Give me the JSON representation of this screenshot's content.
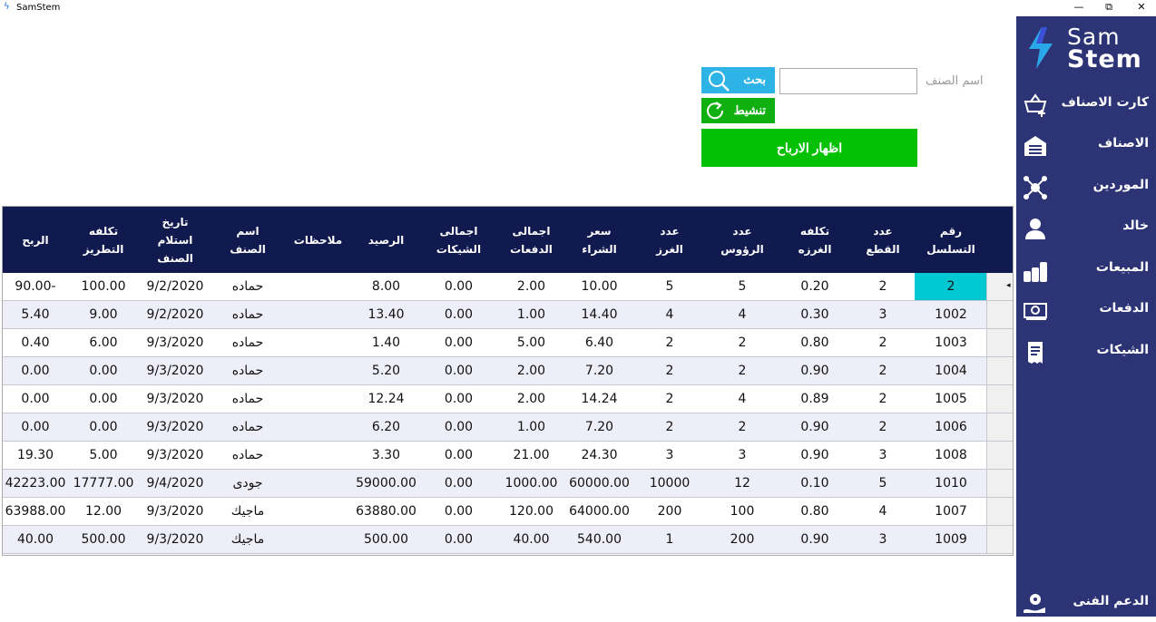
{
  "window": {
    "title": "SamStem",
    "logo_glyph": "ϟ",
    "minimize": "—",
    "restore": "⧉",
    "close": "✕"
  },
  "brand": {
    "line1": "Sam",
    "line2": "Stem"
  },
  "nav": [
    {
      "label": "كارت الاصناف",
      "icon": "basket-plus-icon"
    },
    {
      "label": "الاصناف",
      "icon": "warehouse-icon"
    },
    {
      "label": "الموردين",
      "icon": "network-icon"
    },
    {
      "label": "خالد",
      "icon": "user-icon"
    },
    {
      "label": "المبيعات",
      "icon": "coins-icon"
    },
    {
      "label": "الدفعات",
      "icon": "banknote-icon"
    },
    {
      "label": "الشيكات",
      "icon": "receipt-icon"
    },
    {
      "label": "الدعم الفنى",
      "icon": "support-icon"
    }
  ],
  "form": {
    "name_label": "اسم الصنف",
    "name_value": "",
    "search_label": "بحث",
    "refresh_label": "تنشيط",
    "profit_label": "اظهار الارباح"
  },
  "table": {
    "columns": [
      "رقم\nالتسلسل",
      "عدد\nالقطع",
      "تكلفه\nالغرزه",
      "عدد\nالرؤوس",
      "عدد\nالغرز",
      "سعر\nالشراء",
      "اجمالى\nالدفعات",
      "اجمالى\nالشيكات",
      "الرصيد",
      "ملاحظات",
      "اسم\nالصنف",
      "تاريخ\nاستلام\nالصنف",
      "تكلفه\nالتطريز",
      "الربح"
    ],
    "rows": [
      [
        "2",
        "2",
        "0.20",
        "5",
        "5",
        "10.00",
        "2.00",
        "0.00",
        "8.00",
        "",
        "حماده",
        "9/2/2020",
        "100.00",
        "90.00-"
      ],
      [
        "1002",
        "3",
        "0.30",
        "4",
        "4",
        "14.40",
        "1.00",
        "0.00",
        "13.40",
        "",
        "حماده",
        "9/2/2020",
        "9.00",
        "5.40"
      ],
      [
        "1003",
        "2",
        "0.80",
        "2",
        "2",
        "6.40",
        "5.00",
        "0.00",
        "1.40",
        "",
        "حماده",
        "9/3/2020",
        "6.00",
        "0.40"
      ],
      [
        "1004",
        "2",
        "0.90",
        "2",
        "2",
        "7.20",
        "2.00",
        "0.00",
        "5.20",
        "",
        "حماده",
        "9/3/2020",
        "0.00",
        "0.00"
      ],
      [
        "1005",
        "2",
        "0.89",
        "4",
        "2",
        "14.24",
        "2.00",
        "0.00",
        "12.24",
        "",
        "حماده",
        "9/3/2020",
        "0.00",
        "0.00"
      ],
      [
        "1006",
        "2",
        "0.90",
        "2",
        "2",
        "7.20",
        "1.00",
        "0.00",
        "6.20",
        "",
        "حماده",
        "9/3/2020",
        "0.00",
        "0.00"
      ],
      [
        "1008",
        "3",
        "0.90",
        "3",
        "3",
        "24.30",
        "21.00",
        "0.00",
        "3.30",
        "",
        "حماده",
        "9/3/2020",
        "5.00",
        "19.30"
      ],
      [
        "1010",
        "5",
        "0.10",
        "12",
        "10000",
        "60000.00",
        "1000.00",
        "0.00",
        "59000.00",
        "",
        "جودى",
        "9/4/2020",
        "17777.00",
        "42223.00"
      ],
      [
        "1007",
        "4",
        "0.80",
        "100",
        "200",
        "64000.00",
        "120.00",
        "0.00",
        "63880.00",
        "",
        "ماجيك",
        "9/3/2020",
        "12.00",
        "63988.00"
      ],
      [
        "1009",
        "3",
        "0.90",
        "200",
        "1",
        "540.00",
        "40.00",
        "0.00",
        "500.00",
        "",
        "ماجيك",
        "9/3/2020",
        "500.00",
        "40.00"
      ]
    ],
    "current_row_marker": "◂"
  },
  "colors": {
    "sidebar": "#2c3476",
    "header": "#111a4e",
    "selected_cell": "#00c8d2",
    "search_btn": "#2db3e6",
    "green_btn": "#05c105"
  }
}
